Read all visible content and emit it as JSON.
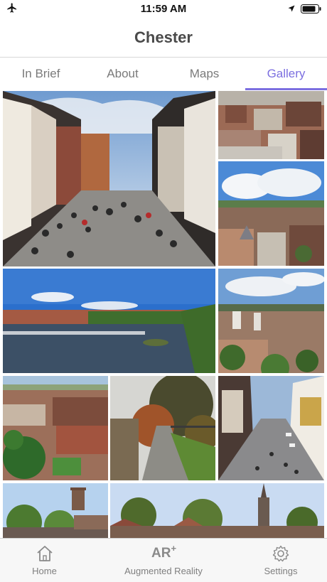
{
  "status_bar": {
    "time": "11:59 AM",
    "icons": [
      "airplane-icon",
      "location-arrow-icon",
      "battery-icon"
    ]
  },
  "header": {
    "title": "Chester"
  },
  "tabs": [
    {
      "label": "In Brief",
      "active": false
    },
    {
      "label": "About",
      "active": false
    },
    {
      "label": "Maps",
      "active": false
    },
    {
      "label": "Gallery",
      "active": true
    }
  ],
  "gallery": {
    "photos": [
      {
        "subject": "Tudor-style street with crowds of pedestrians"
      },
      {
        "subject": "Aerial view of rooftops"
      },
      {
        "subject": "Panorama of town and blue sky"
      },
      {
        "subject": "River with weir and trees"
      },
      {
        "subject": "View over city towards tower blocks"
      },
      {
        "subject": "Aerial view with trees and houses"
      },
      {
        "subject": "City wall walkway through autumn trees"
      },
      {
        "subject": "High street looking downhill"
      },
      {
        "subject": "Cathedral tower behind trees"
      },
      {
        "subject": "Town skyline with church spire"
      }
    ]
  },
  "bottom_bar": {
    "items": [
      {
        "label": "Home",
        "icon": "home-icon"
      },
      {
        "label": "Augmented Reality",
        "icon": "ar-icon",
        "icon_text": "AR",
        "icon_sup": "+"
      },
      {
        "label": "Settings",
        "icon": "gear-icon"
      }
    ]
  },
  "colors": {
    "accent": "#7c6fe0",
    "inactive": "#7a7a7a",
    "title": "#4a4a4a"
  }
}
